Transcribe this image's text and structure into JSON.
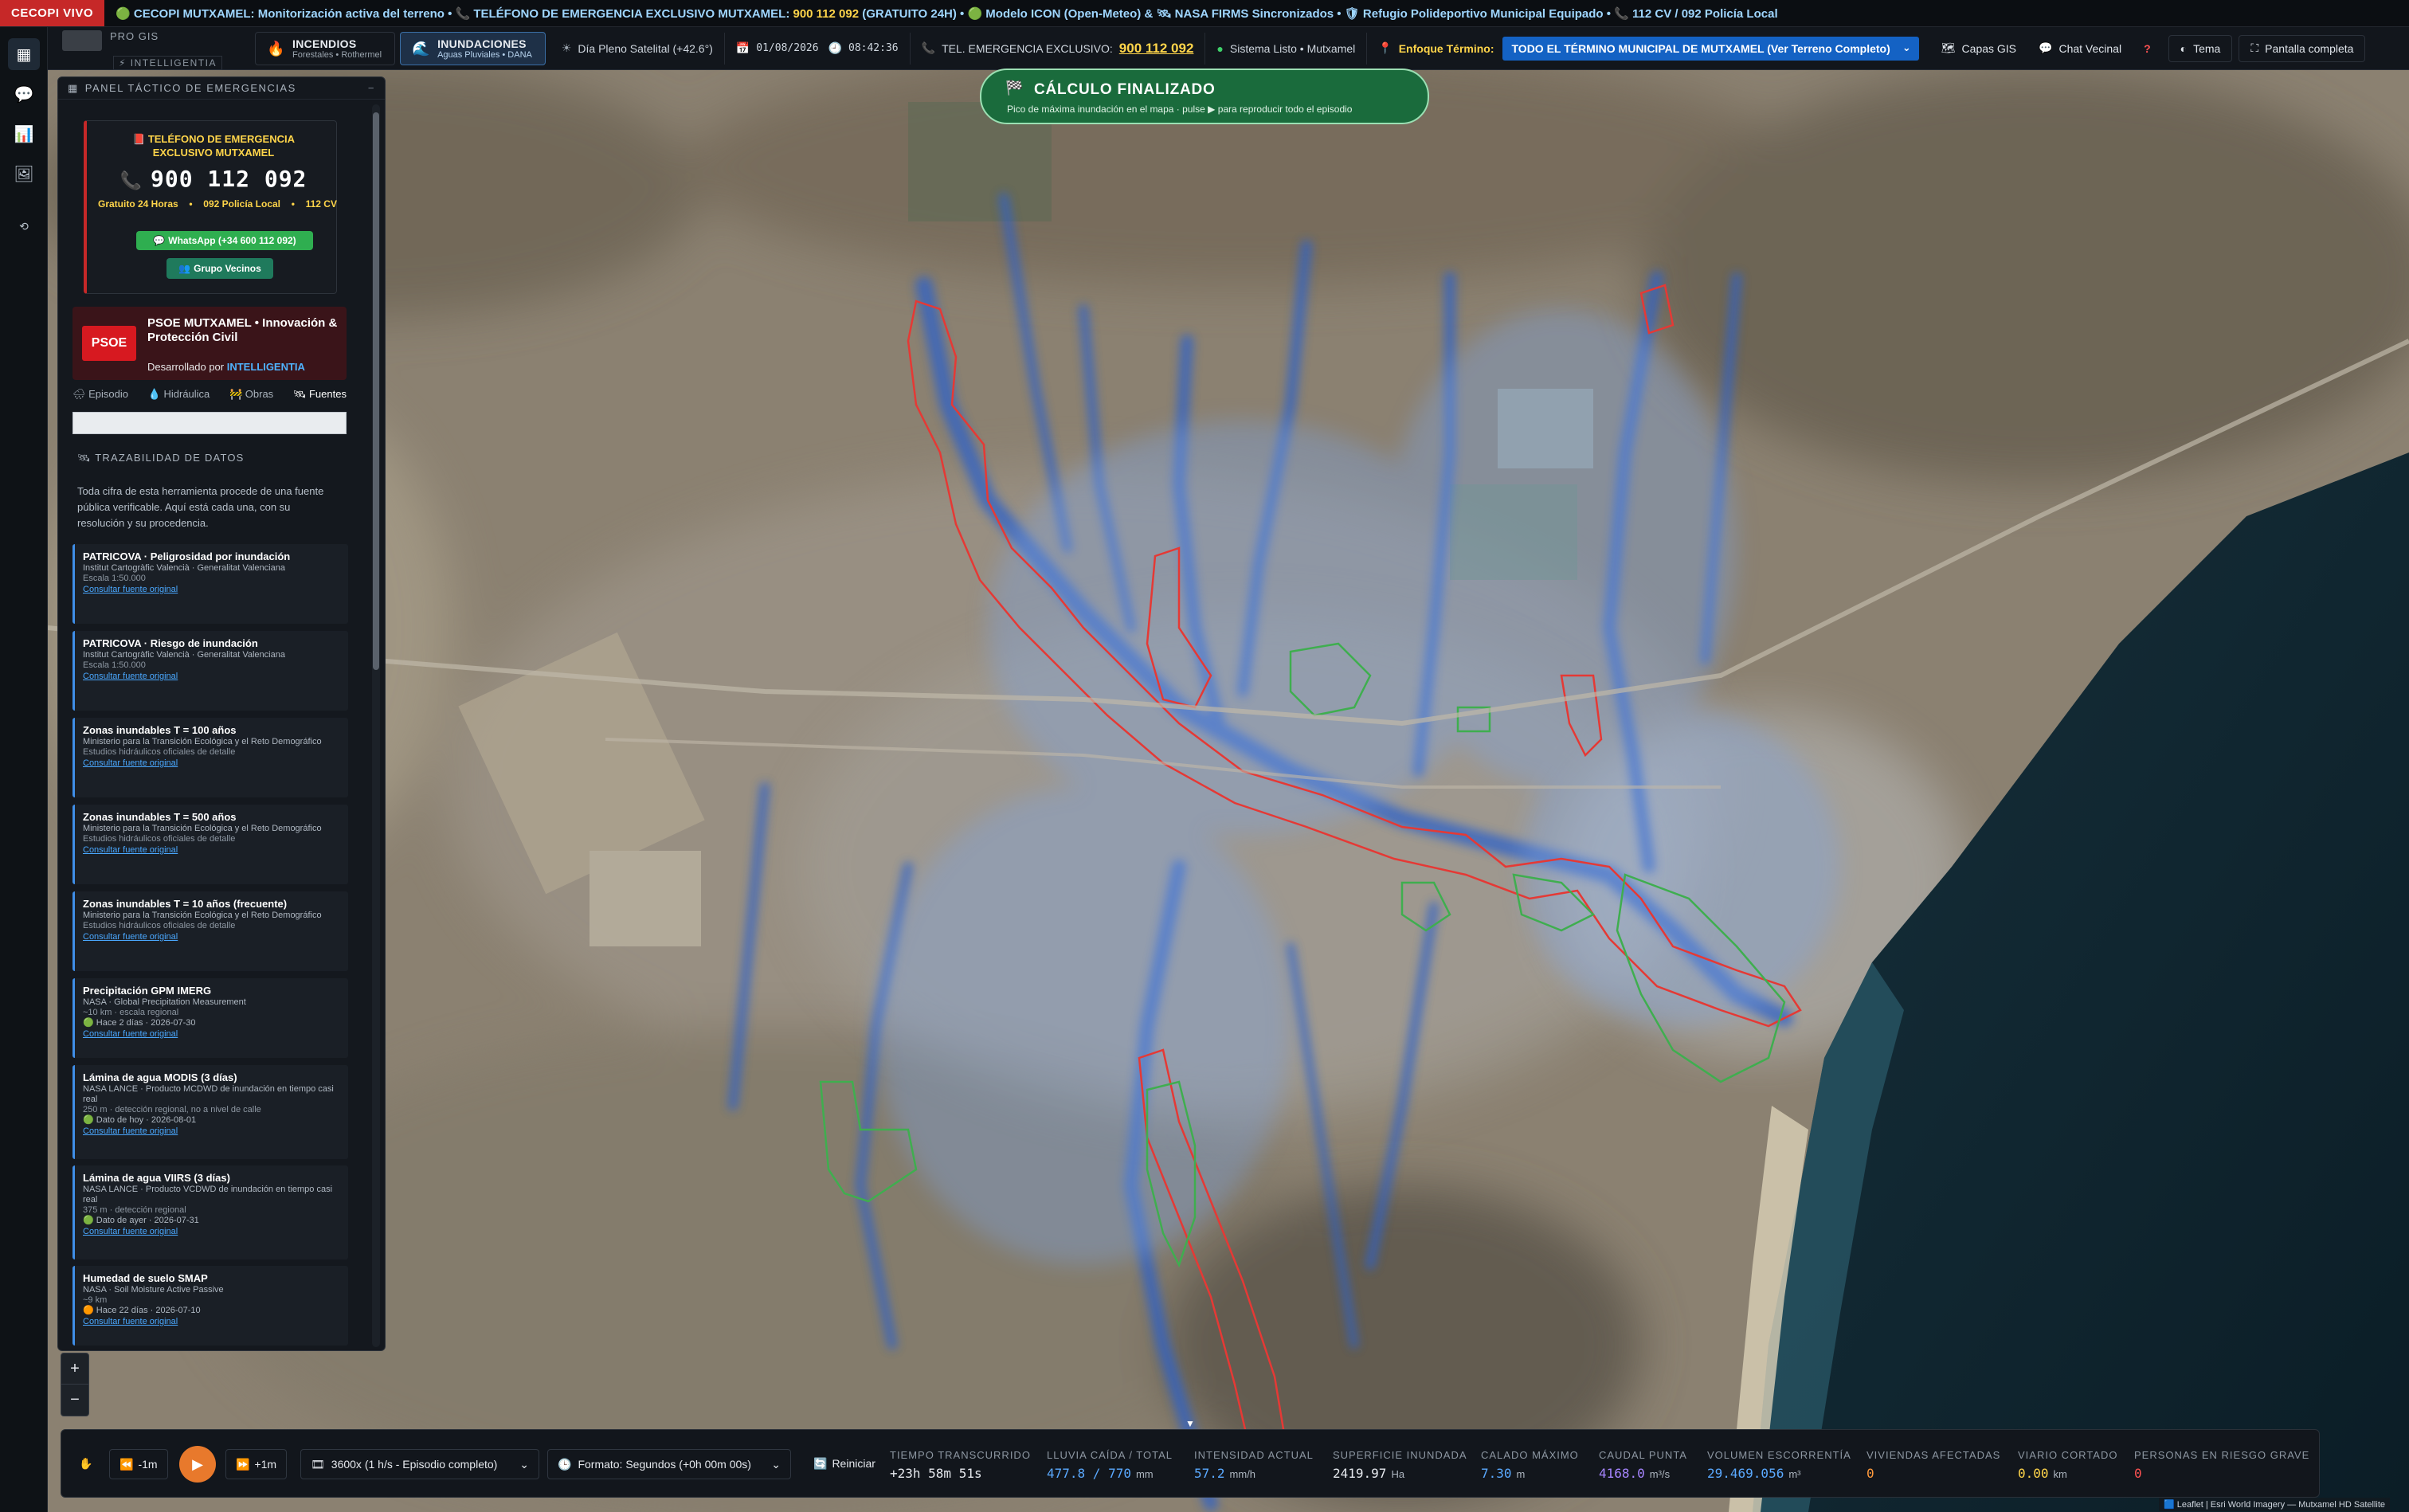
{
  "ticker": {
    "badge": "CECOPI VIVO",
    "text_a": "🟢 CECOPI MUTXAMEL: Monitorización activa del terreno • 📞 TELÉFONO DE EMERGENCIA EXCLUSIVO MUTXAMEL: ",
    "number": "900 112 092",
    "text_b": " (GRATUITO 24H) • 🟢 Modelo ICON (Open-Meteo) & 🛰 NASA FIRMS Sincronizados • 🛡 Refugio Polideportivo Municipal Equipado • 📞 112 CV / 092 Policía Local"
  },
  "brand": {
    "pro": "PRO GIS",
    "intelligentia": "⚡ INTELLIGENTIA"
  },
  "modes": [
    {
      "title": "INCENDIOS",
      "subtitle": "Forestales • Rothermel",
      "icon": "flame-icon"
    },
    {
      "title": "INUNDACIONES",
      "subtitle": "Aguas Pluviales • DANA",
      "icon": "water-icon"
    }
  ],
  "toolbar": {
    "weather": "Día Pleno Satelital (+42.6°)",
    "date": "01/08/2026",
    "time": "08:42:36",
    "emergency_label": "TEL. EMERGENCIA EXCLUSIVO:",
    "emergency_number": "900 112 092",
    "system": "Sistema Listo • Mutxamel",
    "focus_label": "Enfoque Término:",
    "focus_value": "TODO EL TÉRMINO MUNICIPAL DE MUTXAMEL (Ver Terreno Completo)",
    "layers": "Capas GIS",
    "chat": "Chat Vecinal",
    "help": "?",
    "theme": "Tema",
    "fullscreen": "Pantalla completa"
  },
  "panel": {
    "header": "PANEL TÁCTICO DE EMERGENCIAS",
    "emergency": {
      "title": "TELÉFONO DE EMERGENCIA EXCLUSIVO MUTXAMEL",
      "number": "900 112 092",
      "info1": "Gratuito 24 Horas",
      "info2": "092 Policía Local",
      "info3": "112 CV",
      "whatsapp": "WhatsApp (+34 600 112 092)",
      "group": "Grupo Vecinos"
    },
    "psoe": {
      "logo": "PSOE",
      "title": "PSOE MUTXAMEL • Innovación & Protección Civil",
      "dev_prefix": "Desarrollado por ",
      "dev_name": "INTELLIGENTIA"
    },
    "tabs": [
      "Episodio",
      "Hidráulica",
      "Obras",
      "Fuentes"
    ],
    "trace_heading": "TRAZABILIDAD DE DATOS",
    "trace_desc": "Toda cifra de esta herramienta procede de una fuente pública verificable. Aquí está cada una, con su resolución y su procedencia.",
    "sources": [
      {
        "title": "PATRICOVA · Peligrosidad por inundación",
        "org": "Institut Cartogràfic Valencià · Generalitat Valenciana",
        "meta": "Escala 1:50.000",
        "link": "Consultar fuente original"
      },
      {
        "title": "PATRICOVA · Riesgo de inundación",
        "org": "Institut Cartogràfic Valencià · Generalitat Valenciana",
        "meta": "Escala 1:50.000",
        "link": "Consultar fuente original"
      },
      {
        "title": "Zonas inundables T = 100 años",
        "org": "Ministerio para la Transición Ecológica y el Reto Demográfico",
        "meta": "Estudios hidráulicos oficiales de detalle",
        "link": "Consultar fuente original"
      },
      {
        "title": "Zonas inundables T = 500 años",
        "org": "Ministerio para la Transición Ecológica y el Reto Demográfico",
        "meta": "Estudios hidráulicos oficiales de detalle",
        "link": "Consultar fuente original"
      },
      {
        "title": "Zonas inundables T = 10 años (frecuente)",
        "org": "Ministerio para la Transición Ecológica y el Reto Demográfico",
        "meta": "Estudios hidráulicos oficiales de detalle",
        "link": "Consultar fuente original"
      },
      {
        "title": "Precipitación GPM IMERG",
        "org": "NASA · Global Precipitation Measurement",
        "meta": "~10 km · escala regional",
        "status": "🟢 Hace 2 días · 2026-07-30",
        "link": "Consultar fuente original"
      },
      {
        "title": "Lámina de agua MODIS (3 días)",
        "org": "NASA LANCE · Producto MCDWD de inundación en tiempo casi real",
        "meta": "250 m · detección regional, no a nivel de calle",
        "status": "🟢 Dato de hoy · 2026-08-01",
        "link": "Consultar fuente original"
      },
      {
        "title": "Lámina de agua VIIRS (3 días)",
        "org": "NASA LANCE · Producto VCDWD de inundación en tiempo casi real",
        "meta": "375 m · detección regional",
        "status": "🟢 Dato de ayer · 2026-07-31",
        "link": "Consultar fuente original"
      },
      {
        "title": "Humedad de suelo SMAP",
        "org": "NASA · Soil Moisture Active Passive",
        "meta": "~9 km",
        "status": "🟠 Hace 22 días · 2026-07-10",
        "link": "Consultar fuente original"
      }
    ]
  },
  "banner": {
    "title": "CÁLCULO FINALIZADO",
    "subtitle": "Pico de máxima inundación en el mapa · pulse ▶ para reproducir todo el episodio"
  },
  "zoom": {
    "in": "+",
    "out": "−"
  },
  "timeline": {
    "back": "-1m",
    "fwd": "+1m",
    "speed": "3600x (1 h/s - Episodio completo)",
    "format": "Formato: Segundos (+0h 00m 00s)",
    "reset": "Reiniciar",
    "stats": [
      {
        "label": "TIEMPO TRANSCURRIDO",
        "value": "+23h 58m 51s",
        "unit": "",
        "color": "#ffffff"
      },
      {
        "label": "LLUVIA CAÍDA / TOTAL",
        "value": "477.8 / 770",
        "unit": "mm",
        "color": "#5aa9ff"
      },
      {
        "label": "INTENSIDAD ACTUAL",
        "value": "57.2",
        "unit": "mm/h",
        "color": "#5aa9ff"
      },
      {
        "label": "SUPERFICIE INUNDADA",
        "value": "2419.97",
        "unit": "Ha",
        "color": "#ffffff"
      },
      {
        "label": "CALADO MÁXIMO",
        "value": "7.30",
        "unit": "m",
        "color": "#5aa9ff"
      },
      {
        "label": "CAUDAL PUNTA",
        "value": "4168.0",
        "unit": "m³/s",
        "color": "#a685ff"
      },
      {
        "label": "VOLUMEN ESCORRENTÍA",
        "value": "29.469.056",
        "unit": "m³",
        "color": "#5aa9ff"
      },
      {
        "label": "VIVIENDAS AFECTADAS",
        "value": "0",
        "unit": "",
        "color": "#ff9a3c"
      },
      {
        "label": "VIARIO CORTADO",
        "value": "0.00",
        "unit": "km",
        "color": "#ffd54a"
      },
      {
        "label": "PERSONAS EN RIESGO GRAVE",
        "value": "0",
        "unit": "",
        "color": "#ff5252"
      }
    ]
  },
  "attribution": "🟦 Leaflet | Esri World Imagery — Mutxamel HD Satellite"
}
